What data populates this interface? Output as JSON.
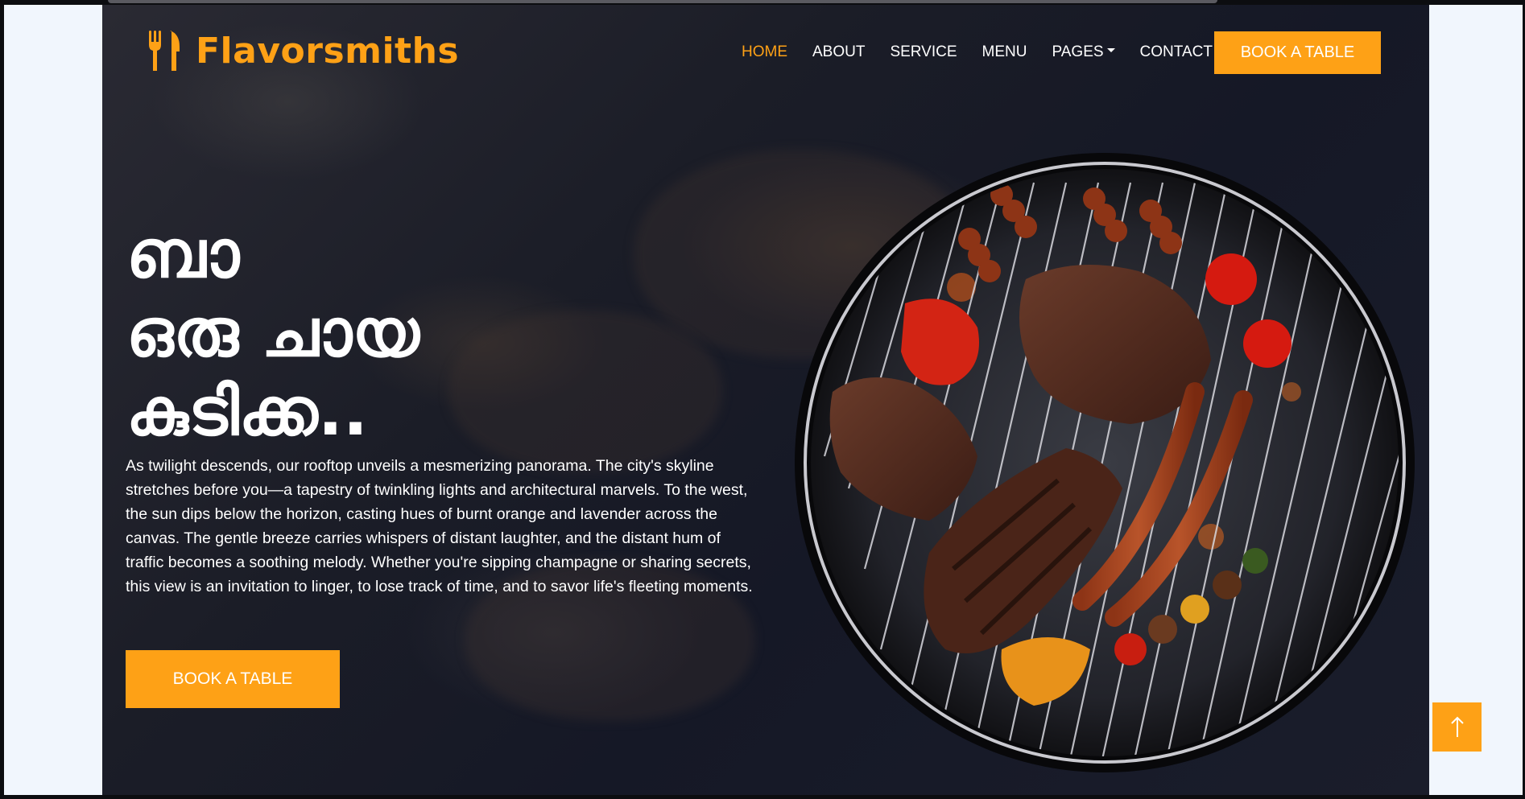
{
  "brand": {
    "name": "Flavorsmiths",
    "icon": "utensils-icon",
    "color": "#fea116"
  },
  "nav": {
    "items": [
      {
        "label": "HOME",
        "active": true
      },
      {
        "label": "ABOUT"
      },
      {
        "label": "SERVICE"
      },
      {
        "label": "MENU"
      },
      {
        "label": "PAGES",
        "dropdown": true
      },
      {
        "label": "CONTACT"
      }
    ],
    "cta_label": "BOOK A TABLE"
  },
  "hero": {
    "title_lines": [
      "ബാ",
      "ഒരു ചായ",
      "കുടിക്ക.."
    ],
    "description": "As twilight descends, our rooftop unveils a mesmerizing panorama. The city's skyline stretches before you—a tapestry of twinkling lights and architectural marvels. To the west, the sun dips below the horizon, casting hues of burnt orange and lavender across the canvas. The gentle breeze carries whispers of distant laughter, and the distant hum of traffic becomes a soothing melody. Whether you're sipping champagne or sharing secrets, this view is an invitation to linger, to lose track of time, and to savor life's fleeting moments.",
    "button_label": "BOOK A TABLE",
    "image": "grilled-bbq-platter"
  },
  "back_to_top": {
    "icon": "arrow-up-icon"
  },
  "colors": {
    "accent": "#fea116",
    "background": "#1b1d27",
    "text": "#ffffff"
  }
}
